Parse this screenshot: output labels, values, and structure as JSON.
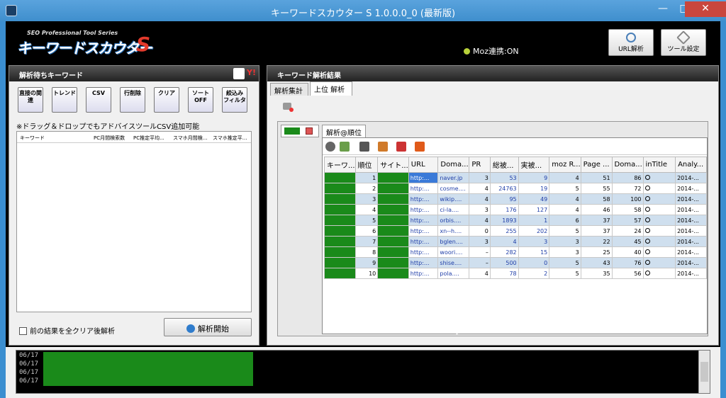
{
  "window": {
    "title": "キーワードスカウター S 1.0.0.0_0 (最新版)",
    "min": "—",
    "max": "□",
    "close": "✕"
  },
  "header": {
    "logo_sub": "SEO Professional Tool Series",
    "logo_main": "キーワードスカウター",
    "logo_s": "S",
    "moz_status": "Moz連携:ON",
    "url_button": "URL解析",
    "tool_button": "ツール設定"
  },
  "left": {
    "title": "解析待ちキーワード",
    "tools": [
      {
        "label": "直接の関連"
      },
      {
        "label": "トレンド"
      },
      {
        "label": "CSV"
      },
      {
        "label": "行削除"
      },
      {
        "label": "クリア"
      },
      {
        "label": "ソートOFF"
      },
      {
        "label": "絞込み フィルタ"
      }
    ],
    "note": "※ドラッグ＆ドロップでもアドバイスツールCSV追加可能",
    "columns": [
      "キーワード",
      "PC月間検索数",
      "PC推定平均...",
      "スマホ月間検...",
      "スマホ推定平..."
    ],
    "checkbox_label": "前の結果を全クリア後解析",
    "start_button": "解析開始"
  },
  "right": {
    "title": "キーワード解析結果",
    "tabs": [
      "解析集計",
      "上位 解析"
    ],
    "subtab": "解析@順位",
    "columns": [
      "キーワ...",
      "順位",
      "サイト...",
      "URL",
      "Doma...",
      "PR",
      "総被...",
      "実被...",
      "moz R...",
      "Page ...",
      "Doma...",
      "inTitle",
      "Analy..."
    ],
    "rows": [
      {
        "rank": "1",
        "url": "http:...",
        "domain": "naver.jp",
        "pr": "3",
        "total": "53",
        "real": "9",
        "moz": "4",
        "page": "51",
        "da": "86",
        "date": "2014-..."
      },
      {
        "rank": "2",
        "url": "http:...",
        "domain": "cosme....",
        "pr": "4",
        "total": "24763",
        "real": "19",
        "moz": "5",
        "page": "55",
        "da": "72",
        "date": "2014-..."
      },
      {
        "rank": "3",
        "url": "http:...",
        "domain": "wikip....",
        "pr": "4",
        "total": "95",
        "real": "49",
        "moz": "4",
        "page": "58",
        "da": "100",
        "date": "2014-..."
      },
      {
        "rank": "4",
        "url": "http:...",
        "domain": "ci-la....",
        "pr": "3",
        "total": "176",
        "real": "127",
        "moz": "4",
        "page": "46",
        "da": "58",
        "date": "2014-..."
      },
      {
        "rank": "5",
        "url": "http:...",
        "domain": "orbis....",
        "pr": "4",
        "total": "1893",
        "real": "1",
        "moz": "6",
        "page": "37",
        "da": "57",
        "date": "2014-..."
      },
      {
        "rank": "6",
        "url": "http:...",
        "domain": "xn--h....",
        "pr": "0",
        "total": "255",
        "real": "202",
        "moz": "5",
        "page": "37",
        "da": "24",
        "date": "2014-..."
      },
      {
        "rank": "7",
        "url": "http:...",
        "domain": "bglen....",
        "pr": "3",
        "total": "4",
        "real": "3",
        "moz": "3",
        "page": "22",
        "da": "45",
        "date": "2014-..."
      },
      {
        "rank": "8",
        "url": "http:...",
        "domain": "woori....",
        "pr": "–",
        "total": "282",
        "real": "15",
        "moz": "3",
        "page": "25",
        "da": "40",
        "date": "2014-..."
      },
      {
        "rank": "9",
        "url": "http:...",
        "domain": "shise....",
        "pr": "–",
        "total": "500",
        "real": "0",
        "moz": "5",
        "page": "43",
        "da": "76",
        "date": "2014-..."
      },
      {
        "rank": "10",
        "url": "http:...",
        "domain": "pola....",
        "pr": "4",
        "total": "78",
        "real": "2",
        "moz": "5",
        "page": "35",
        "da": "56",
        "date": "2014-..."
      }
    ]
  },
  "log": {
    "lines": [
      "06/17",
      "06/17",
      "06/17",
      "06/17"
    ]
  }
}
